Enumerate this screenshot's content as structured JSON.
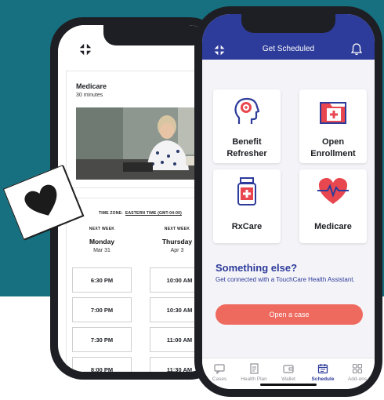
{
  "back_phone": {
    "service_title": "Medicare",
    "service_duration": "30 minutes",
    "timezone_label": "TIME ZONE:",
    "timezone_value": "EASTERN TIME (GMT-04:00)",
    "columns": [
      {
        "label": "NEXT WEEK",
        "day": "Monday",
        "date": "Mar 31",
        "slots": [
          "6:30 PM",
          "7:00 PM",
          "7:30 PM",
          "8:00 PM"
        ]
      },
      {
        "label": "NEXT WEEK",
        "day": "Thursday",
        "date": "Apr 3",
        "slots": [
          "10:00 AM",
          "10:30 AM",
          "11:00 AM",
          "11:30 AM"
        ]
      }
    ]
  },
  "front_phone": {
    "header_title": "Get Scheduled",
    "tiles": [
      {
        "label": "Benefit Refresher",
        "icon": "brain-head-icon"
      },
      {
        "label": "Open Enrollment",
        "icon": "medical-folder-icon"
      },
      {
        "label": "RxCare",
        "icon": "pill-bottle-icon"
      },
      {
        "label": "Medicare",
        "icon": "heart-pulse-icon"
      }
    ],
    "else_title": "Something else?",
    "else_desc": "Get connected with a TouchCare Health Assistant.",
    "open_case_label": "Open a case",
    "tabs": [
      {
        "label": "Cases",
        "icon": "chat-icon"
      },
      {
        "label": "Health Plan",
        "icon": "document-icon"
      },
      {
        "label": "Wallet",
        "icon": "wallet-icon"
      },
      {
        "label": "Schedule",
        "icon": "calendar-icon",
        "active": true
      },
      {
        "label": "Add-ons",
        "icon": "grid-icon"
      }
    ]
  },
  "colors": {
    "brand_blue": "#2d3b9a",
    "teal_bg": "#17707f",
    "coral": "#ee6a5f",
    "icon_red": "#e8474f"
  }
}
